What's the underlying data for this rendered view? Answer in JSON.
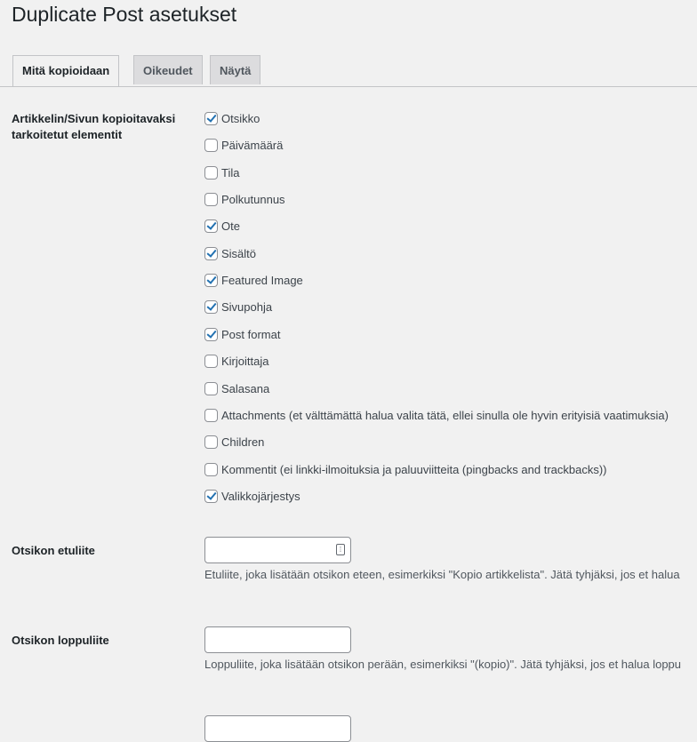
{
  "page": {
    "title": "Duplicate Post asetukset"
  },
  "tabs": [
    {
      "label": "Mitä kopioidaan",
      "active": true
    },
    {
      "label": "Oikeudet",
      "active": false
    },
    {
      "label": "Näytä",
      "active": false
    }
  ],
  "elements_section": {
    "label": "Artikkelin/Sivun kopioitavaksi tarkoitetut elementit",
    "items": [
      {
        "label": "Otsikko",
        "checked": true
      },
      {
        "label": "Päivämäärä",
        "checked": false
      },
      {
        "label": "Tila",
        "checked": false
      },
      {
        "label": "Polkutunnus",
        "checked": false
      },
      {
        "label": "Ote",
        "checked": true
      },
      {
        "label": "Sisältö",
        "checked": true
      },
      {
        "label": "Featured Image",
        "checked": true
      },
      {
        "label": "Sivupohja",
        "checked": true
      },
      {
        "label": "Post format",
        "checked": true
      },
      {
        "label": "Kirjoittaja",
        "checked": false
      },
      {
        "label": "Salasana",
        "checked": false
      },
      {
        "label": "Attachments (et välttämättä halua valita tätä, ellei sinulla ole hyvin erityisiä vaatimuksia)",
        "checked": false
      },
      {
        "label": "Children",
        "checked": false
      },
      {
        "label": "Kommentit (ei linkki-ilmoituksia ja paluuviitteita (pingbacks and trackbacks))",
        "checked": false
      },
      {
        "label": "Valikkojärjestys",
        "checked": true
      }
    ]
  },
  "prefix": {
    "label": "Otsikon etuliite",
    "value": "",
    "help": "Etuliite, joka lisätään otsikon eteen, esimerkiksi \"Kopio artikkelista\". Jätä tyhjäksi, jos et halua"
  },
  "suffix": {
    "label": "Otsikon loppuliite",
    "value": "",
    "help": "Loppuliite, joka lisätään otsikon perään, esimerkiksi \"(kopio)\". Jätä tyhjäksi, jos et halua loppu"
  }
}
